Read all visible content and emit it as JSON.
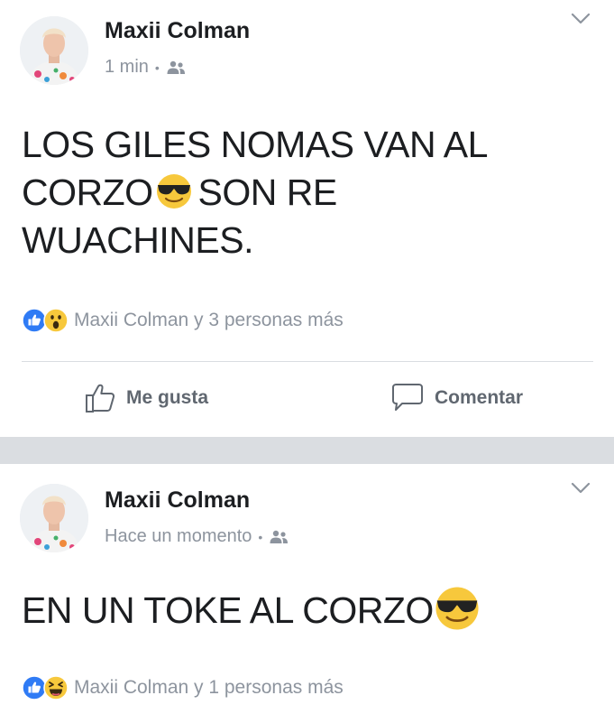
{
  "posts": [
    {
      "author": "Maxii Colman",
      "time": "1 min",
      "text_lines": [
        "LOS GILES NOMAS VAN AL",
        "CORZO",
        "SON RE",
        "WUACHINES."
      ],
      "reactions_text": "Maxii Colman y 3 personas más",
      "reaction_icons": [
        "like-reaction-icon",
        "wow-reaction-icon"
      ]
    },
    {
      "author": "Maxii Colman",
      "time": "Hace un momento",
      "text": "EN UN TOKE AL CORZO",
      "reactions_text": "Maxii Colman y 1 personas más",
      "reaction_icons": [
        "like-reaction-icon",
        "haha-reaction-icon"
      ]
    }
  ],
  "actions": {
    "like_label": "Me gusta",
    "comment_label": "Comentar"
  },
  "colors": {
    "like_blue": "#2f7bf5",
    "reaction_yellow": "#f7c83c",
    "meta_gray": "#8d949e",
    "separator_gray": "#dadde1"
  }
}
